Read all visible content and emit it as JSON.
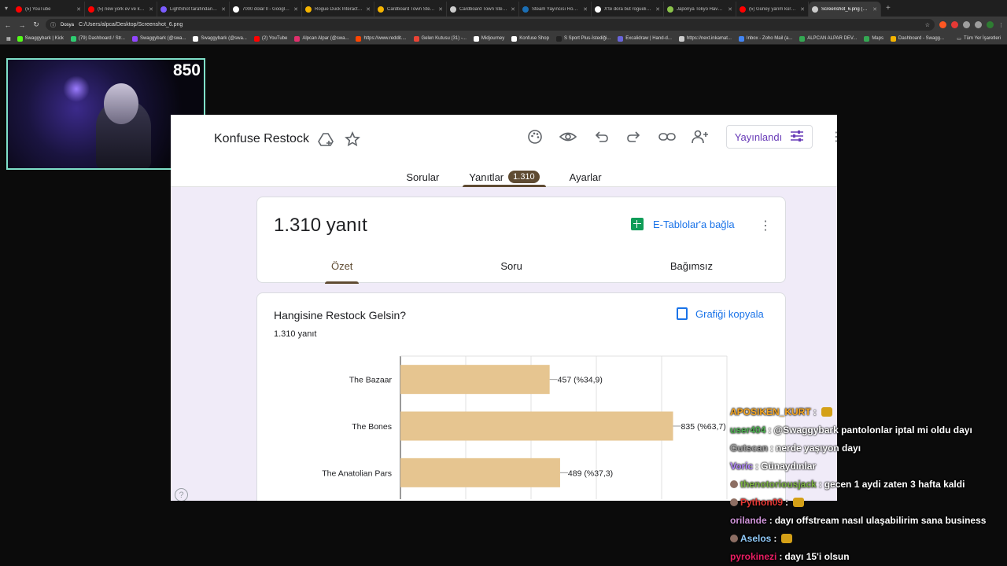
{
  "browser": {
    "tabs": [
      {
        "label": "(5) YouTube",
        "color": "#ff0000"
      },
      {
        "label": "(5) new york ev ve kal...",
        "color": "#ff0000"
      },
      {
        "label": "LightShot tarafından İ...",
        "color": "#7b5cff"
      },
      {
        "label": "7000 dolar ll - Google...",
        "color": "#ffffff"
      },
      {
        "label": "Rogue Duck Interactiv...",
        "color": "#f5b400"
      },
      {
        "label": "Cardboard Town Stea...",
        "color": "#f5b400"
      },
      {
        "label": "Cardboard Town Steal...",
        "color": "#cccccc"
      },
      {
        "label": "Steam Yayıncısı Rogue...",
        "color": "#1b6fb5"
      },
      {
        "label": "X'te dora but roguelik...",
        "color": "#ffffff"
      },
      {
        "label": "Japonya Tokyo Hava D...",
        "color": "#8bc34a"
      },
      {
        "label": "(5) Güney yarım küred...",
        "color": "#ff0000"
      },
      {
        "label": "Screenshot_6.png (1609...",
        "color": "#cccccc"
      }
    ],
    "url_chip": "Dosya",
    "url": "C:/Users/alpca/Desktop/Screenshot_6.png",
    "bookmarks": [
      {
        "label": "Swaggybark | Kick",
        "color": "#53fc18"
      },
      {
        "label": "(79) Dashboard / Str...",
        "color": "#2ecc71"
      },
      {
        "label": "Swaggybark (@swa...",
        "color": "#9146ff"
      },
      {
        "label": "Swaggybark (@swa...",
        "color": "#ffffff"
      },
      {
        "label": "(2) YouTube",
        "color": "#ff0000"
      },
      {
        "label": "Alpcan Alpar (@swa...",
        "color": "#e1306c"
      },
      {
        "label": "https://www.reddit....",
        "color": "#ff4500"
      },
      {
        "label": "Gelen Kutusu (31) -...",
        "color": "#ea4335"
      },
      {
        "label": "Midjourney",
        "color": "#ffffff"
      },
      {
        "label": "Konfuse Shop",
        "color": "#ffffff"
      },
      {
        "label": "S Sport Plus-İstediği...",
        "color": "#222222"
      },
      {
        "label": "Excalidraw | Hand-d...",
        "color": "#6965db"
      },
      {
        "label": "https://next.inkamat...",
        "color": "#cccccc"
      },
      {
        "label": "Inbox - Zoho Mail (a...",
        "color": "#4285f4"
      },
      {
        "label": "ALPCAN ALPAR DEV...",
        "color": "#34a853"
      },
      {
        "label": "Maps",
        "color": "#34a853"
      },
      {
        "label": "Dashboard - Swagg...",
        "color": "#f5b400"
      }
    ],
    "bookmarks_all": "Tüm Yer İşaretleri"
  },
  "webcam": {
    "counter": "850"
  },
  "form": {
    "title": "Konfuse Restock",
    "publish_label": "Yayınlandı",
    "tabs": {
      "questions": "Sorular",
      "responses": "Yanıtlar",
      "responses_count": "1.310",
      "settings": "Ayarlar"
    },
    "summary": {
      "count_text": "1.310 yanıt",
      "sheets_link": "E-Tablolar'a bağla",
      "subtabs": {
        "summary": "Özet",
        "question": "Soru",
        "individual": "Bağımsız"
      }
    },
    "question": {
      "title": "Hangisine Restock Gelsin?",
      "count": "1.310 yanıt",
      "copy_chart": "Grafiği kopyala"
    },
    "accent": "#5f4b32",
    "bar_color": "#e6c590"
  },
  "chart_data": {
    "type": "bar",
    "orientation": "horizontal",
    "categories": [
      "The Bazaar",
      "The Bones",
      "The Anatolian Pars"
    ],
    "values": [
      457,
      835,
      489
    ],
    "data_labels": [
      "457 (%34,9)",
      "835 (%63,7)",
      "489 (%37,3)"
    ],
    "xlim": [
      0,
      1000
    ],
    "grid": true
  },
  "chat": [
    {
      "user": "APOSIKEN_KURT",
      "user_color": "#f5a623",
      "text": "",
      "emote": true,
      "badge": false
    },
    {
      "user": "user404",
      "user_color": "#4caf50",
      "text": "@Swaggybark pantolonlar iptal mi oldu dayı",
      "emote": false,
      "badge": false
    },
    {
      "user": "Gutscan",
      "user_color": "#9e9e9e",
      "text": "nerde yaşıyon dayı",
      "emote": false,
      "badge": false
    },
    {
      "user": "Voric",
      "user_color": "#b388ff",
      "text": "Günaydınlar",
      "emote": false,
      "badge": false
    },
    {
      "user": "thenotoriousjack",
      "user_color": "#7cb342",
      "text": "gecen 1 aydi zaten 3 hafta kaldi",
      "emote": false,
      "badge": true
    },
    {
      "user": "Python09",
      "user_color": "#e53935",
      "text": "",
      "emote": true,
      "badge": true
    },
    {
      "user": "orilande",
      "user_color": "#ce93d8",
      "text": "dayı offstream nasıl ulaşabilirim sana business",
      "emote": false,
      "badge": false
    },
    {
      "user": "Aselos",
      "user_color": "#90caf9",
      "text": "",
      "emote": true,
      "badge": true
    },
    {
      "user": "pyrokinezi",
      "user_color": "#e91e63",
      "text": "dayı 15'i olsun",
      "emote": false,
      "badge": false
    }
  ]
}
